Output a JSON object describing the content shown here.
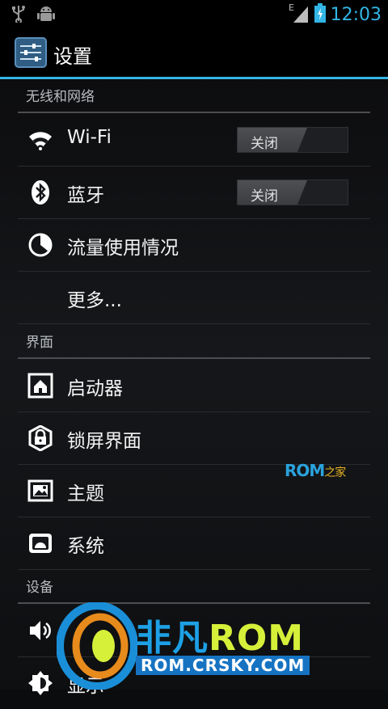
{
  "status_bar": {
    "time": "12:03",
    "network_label": "E",
    "icons": [
      "usb-icon",
      "android-debug-icon",
      "signal-icon",
      "battery-charging-icon"
    ]
  },
  "action_bar": {
    "title": "设置",
    "icon": "settings-sliders-icon"
  },
  "sections": {
    "wireless": {
      "header": "无线和网络"
    },
    "interface": {
      "header": "界面"
    },
    "device": {
      "header": "设备"
    }
  },
  "items": {
    "wifi": {
      "label": "Wi-Fi",
      "icon": "wifi-icon",
      "toggle": "关闭"
    },
    "bluetooth": {
      "label": "蓝牙",
      "icon": "bluetooth-icon",
      "toggle": "关闭"
    },
    "data_usage": {
      "label": "流量使用情况",
      "icon": "data-usage-icon"
    },
    "more": {
      "label": "更多..."
    },
    "launcher": {
      "label": "启动器",
      "icon": "launcher-home-icon"
    },
    "lockscreen": {
      "label": "锁屏界面",
      "icon": "lock-icon"
    },
    "theme": {
      "label": "主题",
      "icon": "theme-image-icon"
    },
    "system": {
      "label": "系统",
      "icon": "system-android-icon"
    },
    "sound": {
      "label": "",
      "icon": "sound-icon"
    },
    "display": {
      "label": "显示",
      "icon": "brightness-icon"
    }
  },
  "watermarks": {
    "rom_home": {
      "rom": "ROM",
      "suffix": "之家"
    },
    "crsky": {
      "brand_cn": "非凡",
      "brand_rom": "ROM",
      "url": "ROM.CRSKY.COM"
    }
  },
  "colors": {
    "accent": "#33b5e5",
    "background": "#0b0c0e",
    "divider": "#4a4d52"
  }
}
